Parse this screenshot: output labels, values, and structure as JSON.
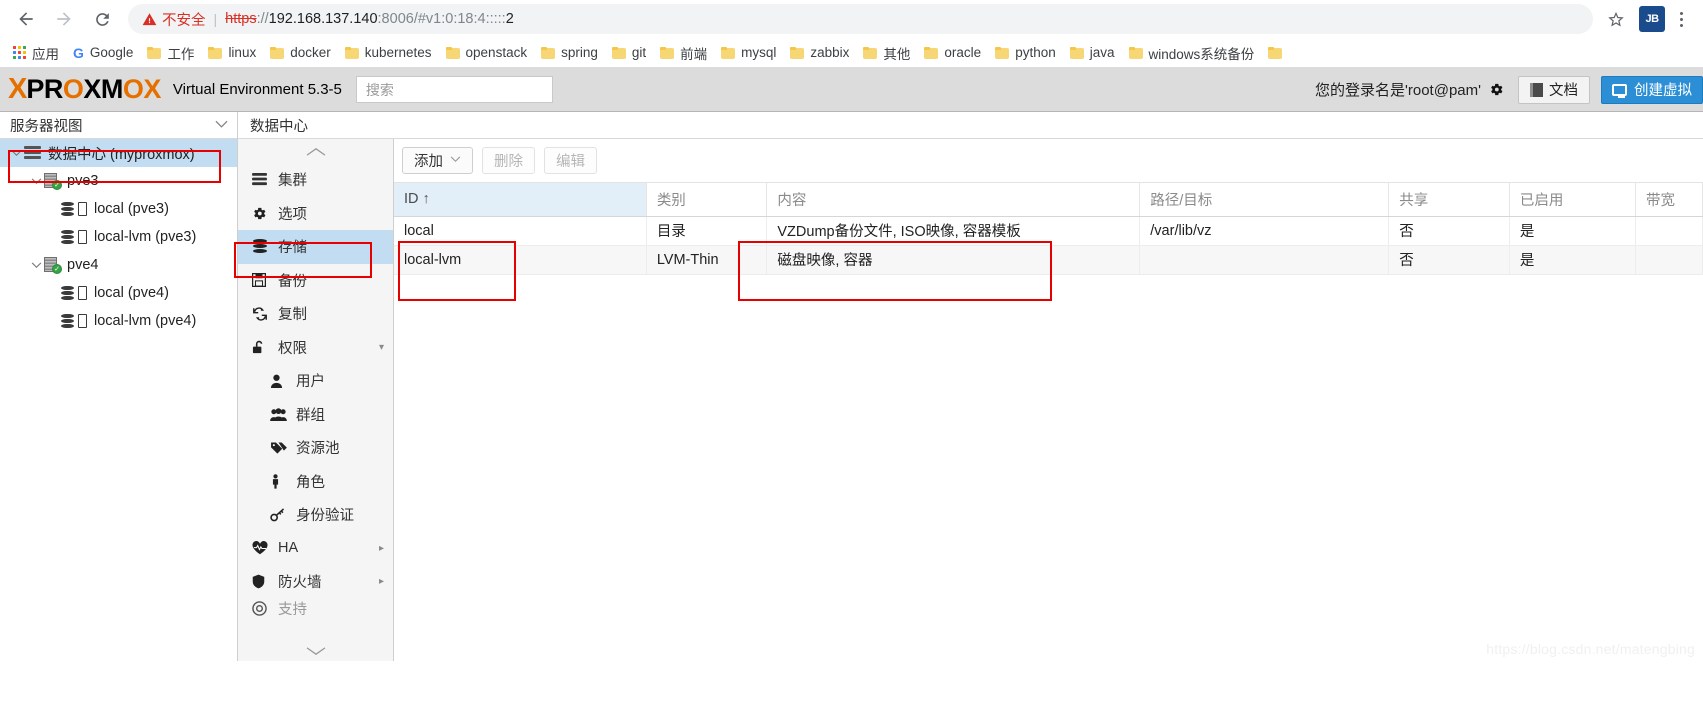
{
  "browser": {
    "back_icon": "back-arrow-icon",
    "forward_icon": "forward-arrow-icon",
    "reload_icon": "reload-icon",
    "insecure_label": "不安全",
    "url_scheme": "https",
    "url_separator": "://",
    "url_host": "192.168.137.140",
    "url_port_path": ":8006/#v1:0:18:4:::::",
    "url_tail": "2",
    "bookmark_star_icon": "star-icon",
    "profile_badge": "JB",
    "menu_icon": "three-dots-menu-icon",
    "bookmarks": [
      {
        "label": "应用",
        "icon": "apps-grid-icon"
      },
      {
        "label": "Google",
        "icon": "google-icon"
      },
      {
        "label": "工作",
        "icon": "folder-icon"
      },
      {
        "label": "linux",
        "icon": "folder-icon"
      },
      {
        "label": "docker",
        "icon": "folder-icon"
      },
      {
        "label": "kubernetes",
        "icon": "folder-icon"
      },
      {
        "label": "openstack",
        "icon": "folder-icon"
      },
      {
        "label": "spring",
        "icon": "folder-icon"
      },
      {
        "label": "git",
        "icon": "folder-icon"
      },
      {
        "label": "前端",
        "icon": "folder-icon"
      },
      {
        "label": "mysql",
        "icon": "folder-icon"
      },
      {
        "label": "zabbix",
        "icon": "folder-icon"
      },
      {
        "label": "其他",
        "icon": "folder-icon"
      },
      {
        "label": "oracle",
        "icon": "folder-icon"
      },
      {
        "label": "python",
        "icon": "folder-icon"
      },
      {
        "label": "java",
        "icon": "folder-icon"
      },
      {
        "label": "windows系统备份",
        "icon": "folder-icon"
      },
      {
        "label": "",
        "icon": "folder-icon"
      }
    ]
  },
  "pve_header": {
    "logo_x": "X",
    "logo_pr": "PR",
    "logo_o": "O",
    "logo_xm": "XM",
    "logo_o2": "O",
    "logo_x2": "X",
    "version": "Virtual Environment 5.3-5",
    "search_placeholder": "搜索",
    "search_value": "",
    "login_text": "您的登录名是'root@pam'",
    "gear_icon": "gear-icon",
    "doc_label": "文档",
    "doc_icon": "book-icon",
    "create_vm_label": "创建虚拟",
    "create_vm_icon": "monitor-icon"
  },
  "tree": {
    "header_label": "服务器视图",
    "header_caret": "chevron-down-icon",
    "nodes": [
      {
        "label": "数据中心 (myproxmox)",
        "icon": "datacenter-icon",
        "level": 0,
        "selected": true,
        "expanded": true
      },
      {
        "label": "pve3",
        "icon": "node-server-icon",
        "level": 1,
        "selected": false,
        "expanded": true
      },
      {
        "label": "local (pve3)",
        "icon": "storage-icon",
        "level": 2,
        "selected": false,
        "expanded": false
      },
      {
        "label": "local-lvm (pve3)",
        "icon": "storage-icon",
        "level": 2,
        "selected": false,
        "expanded": false
      },
      {
        "label": "pve4",
        "icon": "node-server-icon",
        "level": 1,
        "selected": false,
        "expanded": true
      },
      {
        "label": "local (pve4)",
        "icon": "storage-icon",
        "level": 2,
        "selected": false,
        "expanded": false
      },
      {
        "label": "local-lvm (pve4)",
        "icon": "storage-icon",
        "level": 2,
        "selected": false,
        "expanded": false
      }
    ]
  },
  "breadcrumb": {
    "label": "数据中心"
  },
  "menu": {
    "caret_up_icon": "chevron-up-icon",
    "caret_down_icon": "chevron-down-icon",
    "items": [
      {
        "label": "集群",
        "icon": "cluster-icon",
        "sub": false,
        "selected": false,
        "arrow": ""
      },
      {
        "label": "选项",
        "icon": "gear-icon",
        "sub": false,
        "selected": false,
        "arrow": ""
      },
      {
        "label": "存储",
        "icon": "storage-icon",
        "sub": false,
        "selected": true,
        "arrow": ""
      },
      {
        "label": "备份",
        "icon": "floppy-save-icon",
        "sub": false,
        "selected": false,
        "arrow": ""
      },
      {
        "label": "复制",
        "icon": "replication-icon",
        "sub": false,
        "selected": false,
        "arrow": ""
      },
      {
        "label": "权限",
        "icon": "unlock-icon",
        "sub": false,
        "selected": false,
        "arrow": "▾"
      },
      {
        "label": "用户",
        "icon": "user-icon",
        "sub": true,
        "selected": false,
        "arrow": ""
      },
      {
        "label": "群组",
        "icon": "users-group-icon",
        "sub": true,
        "selected": false,
        "arrow": ""
      },
      {
        "label": "资源池",
        "icon": "tag-icon",
        "sub": true,
        "selected": false,
        "arrow": ""
      },
      {
        "label": "角色",
        "icon": "person-icon",
        "sub": true,
        "selected": false,
        "arrow": ""
      },
      {
        "label": "身份验证",
        "icon": "key-icon",
        "sub": true,
        "selected": false,
        "arrow": ""
      },
      {
        "label": "HA",
        "icon": "heartbeat-icon",
        "sub": false,
        "selected": false,
        "arrow": "▸"
      },
      {
        "label": "防火墙",
        "icon": "shield-icon",
        "sub": false,
        "selected": false,
        "arrow": "▸"
      },
      {
        "label": "支持",
        "icon": "lifebuoy-icon",
        "sub": false,
        "selected": false,
        "arrow": ""
      }
    ]
  },
  "toolbar": {
    "add_label": "添加",
    "add_caret_icon": "chevron-down-icon",
    "remove_label": "删除",
    "edit_label": "编辑"
  },
  "table": {
    "columns": [
      {
        "label": "ID",
        "sorted": true,
        "sort_arrow": "↑"
      },
      {
        "label": "类别",
        "sorted": false,
        "sort_arrow": ""
      },
      {
        "label": "内容",
        "sorted": false,
        "sort_arrow": ""
      },
      {
        "label": "路径/目标",
        "sorted": false,
        "sort_arrow": ""
      },
      {
        "label": "共享",
        "sorted": false,
        "sort_arrow": ""
      },
      {
        "label": "已启用",
        "sorted": false,
        "sort_arrow": ""
      },
      {
        "label": "带宽",
        "sorted": false,
        "sort_arrow": ""
      }
    ],
    "rows": [
      {
        "id": "local",
        "type": "目录",
        "content": "VZDump备份文件, ISO映像, 容器模板",
        "path": "/var/lib/vz",
        "shared": "否",
        "enabled": "是",
        "bandwidth": ""
      },
      {
        "id": "local-lvm",
        "type": "LVM-Thin",
        "content": "磁盘映像, 容器",
        "path": "",
        "shared": "否",
        "enabled": "是",
        "bandwidth": ""
      }
    ]
  },
  "watermark": {
    "text": "https://blog.csdn.net/matengbing"
  },
  "colors": {
    "accent_orange": "#e57000",
    "selection_blue": "#c2ddf2",
    "annotation_red": "#e60000",
    "insecure_red": "#d93025",
    "button_blue": "#2c8fd6"
  }
}
